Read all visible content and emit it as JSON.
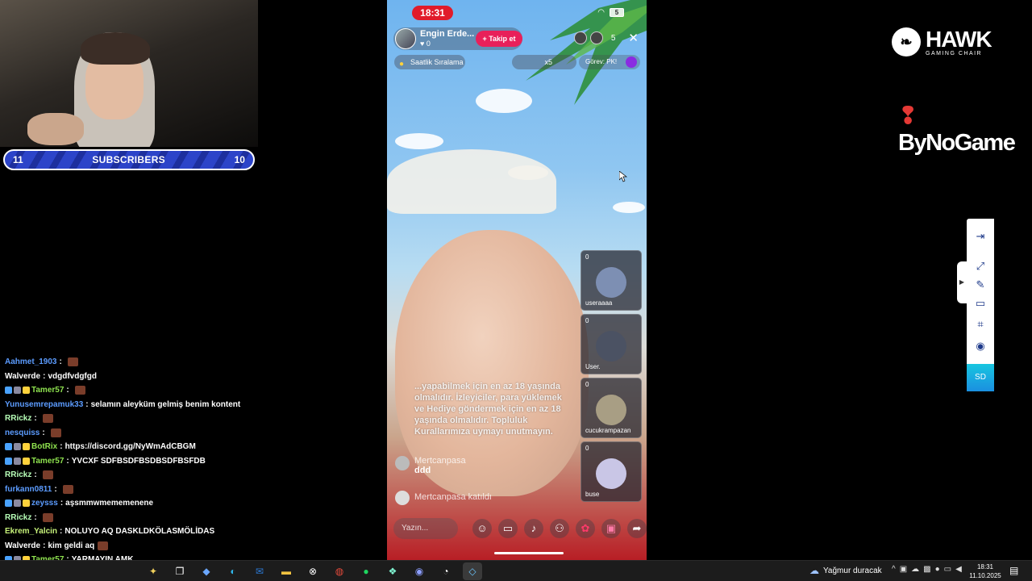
{
  "webcam": {
    "subscribers_left": "11",
    "subscribers_label": "SUBSCRIBERS",
    "subscribers_right": "10"
  },
  "chat": {
    "lines": [
      {
        "user": "Aahmet_1903",
        "sep": ":",
        "msg": "",
        "user_color": "#5c9cff",
        "emote": true
      },
      {
        "user": "Walverde",
        "sep": ":",
        "msg": "vdgdfvdgfgd",
        "user_color": "#ffffff",
        "emote": false
      },
      {
        "user": "Tamer57",
        "sep": ":",
        "msg": "",
        "user_color": "#8fe34f",
        "emote": true,
        "badges": true
      },
      {
        "user": "Yunusemrepamuk33",
        "sep": ":",
        "msg": "selamın aleyküm gelmiş benim kontent",
        "user_color": "#5c9cff",
        "emote": false
      },
      {
        "user": "RRickz",
        "sep": ":",
        "msg": "",
        "user_color": "#b8ffb8",
        "emote": true
      },
      {
        "user": "nesquiss",
        "sep": ":",
        "msg": "",
        "user_color": "#5c9cff",
        "emote": true
      },
      {
        "user": "BotRix",
        "sep": ":",
        "msg": "https://discord.gg/NyWmAdCBGM",
        "user_color": "#8fe34f",
        "emote": false,
        "badges": true
      },
      {
        "user": "Tamer57",
        "sep": ":",
        "msg": "YVCXF SDFBSDFBSDBSDFBSFDB",
        "user_color": "#8fe34f",
        "emote": false,
        "badges": true
      },
      {
        "user": "RRickz",
        "sep": ":",
        "msg": "",
        "user_color": "#b8ffb8",
        "emote": true
      },
      {
        "user": "furkann0811",
        "sep": ":",
        "msg": "",
        "user_color": "#5c9cff",
        "emote": true
      },
      {
        "user": "zeysss",
        "sep": ":",
        "msg": "aşsmmwmememenene",
        "user_color": "#5c9cff",
        "emote": false,
        "badges": true
      },
      {
        "user": "RRickz",
        "sep": ":",
        "msg": "",
        "user_color": "#b8ffb8",
        "emote": true
      },
      {
        "user": "Ekrem_Yalcin",
        "sep": ":",
        "msg": "NOLUYO AQ DASKLDKÖLASMÖLİDAS",
        "user_color": "#c7f27a",
        "emote": false
      },
      {
        "user": "Walverde",
        "sep": ":",
        "msg": "kim geldi aq",
        "user_color": "#ffffff",
        "emote": true
      },
      {
        "user": "Tamer57",
        "sep": ":",
        "msg": "YARMAYIN AMK",
        "user_color": "#8fe34f",
        "emote": false,
        "badges": true
      }
    ]
  },
  "phone": {
    "time": "18:31",
    "battery": "5",
    "host_name": "Engin Erde...",
    "host_likes": "0",
    "follow_label": "+ Takip et",
    "viewer_count": "5",
    "ranking_label": "Saatlik Sıralama",
    "gift_multiplier": "x5",
    "task_label": "Görev: PK!",
    "guests": [
      {
        "count": "0",
        "name": "useraaaa",
        "avatar_color": "#7d8fb3"
      },
      {
        "count": "0",
        "name": "User.",
        "avatar_color": "#4b5263"
      },
      {
        "count": "0",
        "name": "cucukrampazan",
        "avatar_color": "#a89e84"
      },
      {
        "count": "0",
        "name": "buse",
        "avatar_color": "#c9c6e6"
      }
    ],
    "notice": "...yapabilmek için en az 18 yaşında olmalıdır. İzleyiciler, para yüklemek ve Hediye göndermek için en az 18 yaşında olmalıdır. Topluluk Kurallarımıza uymayı unutmayın.",
    "comment_user": "Mertcanpasa",
    "comment_text": "ddd",
    "join_text": "Mertcanpasa katıldı",
    "input_placeholder": "Yazın..."
  },
  "sponsors": {
    "hawk_title": "HAWK",
    "hawk_subtitle": "GAMING CHAIR",
    "bynogame": "ByNoGame"
  },
  "sidebar_tool": {
    "sd_label": "SD"
  },
  "taskbar": {
    "weather": "Yağmur duracak",
    "time": "18:31",
    "date": "11.10.2025"
  }
}
